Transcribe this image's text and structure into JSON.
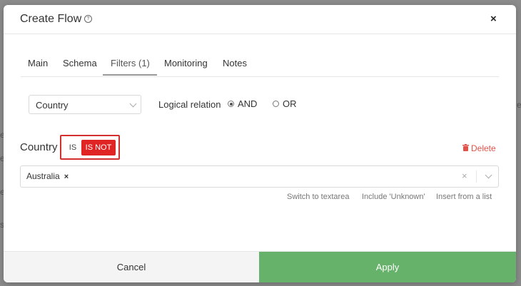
{
  "modal": {
    "title": "Create Flow",
    "help_glyph": "?",
    "close_glyph": "×"
  },
  "tabs": [
    {
      "label": "Main",
      "active": false
    },
    {
      "label": "Schema",
      "active": false
    },
    {
      "label": "Filters (1)",
      "active": true
    },
    {
      "label": "Monitoring",
      "active": false
    },
    {
      "label": "Notes",
      "active": false
    }
  ],
  "filter": {
    "field_select_value": "Country",
    "logical_relation_label": "Logical relation",
    "options": [
      {
        "label": "AND",
        "checked": true
      },
      {
        "label": "OR",
        "checked": false
      }
    ]
  },
  "condition": {
    "label": "Country",
    "toggle": {
      "is": "IS",
      "is_not": "IS NOT",
      "selected": "IS NOT"
    },
    "delete_label": "Delete",
    "values": [
      {
        "label": "Australia",
        "remove_glyph": "×"
      }
    ],
    "clear_glyph": "×",
    "helpers": [
      "Switch to textarea",
      "Include 'Unknown'",
      "Insert from a list"
    ]
  },
  "footer": {
    "cancel_label": "Cancel",
    "apply_label": "Apply"
  },
  "background_glyphs": [
    "e",
    "e",
    "e",
    "s",
    "e"
  ],
  "colors": {
    "apply_bg": "#66b26a",
    "toggle_active_bg": "#e02424",
    "highlight_outline": "#d32f2f",
    "delete_text": "#e0524a"
  }
}
